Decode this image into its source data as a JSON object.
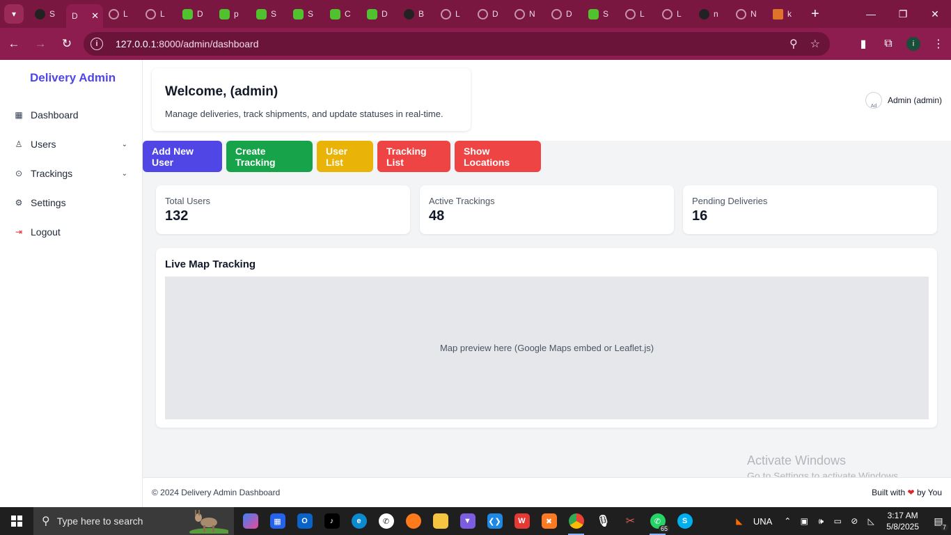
{
  "browser": {
    "tabs": [
      {
        "letter": "S",
        "icon": "dark"
      },
      {
        "letter": "D",
        "icon": "active"
      },
      {
        "letter": "L",
        "icon": "globe"
      },
      {
        "letter": "L",
        "icon": "globe"
      },
      {
        "letter": "D",
        "icon": "green"
      },
      {
        "letter": "p",
        "icon": "green"
      },
      {
        "letter": "S",
        "icon": "green"
      },
      {
        "letter": "S",
        "icon": "green"
      },
      {
        "letter": "C",
        "icon": "green"
      },
      {
        "letter": "D",
        "icon": "green"
      },
      {
        "letter": "B",
        "icon": "dark"
      },
      {
        "letter": "L",
        "icon": "globe"
      },
      {
        "letter": "D",
        "icon": "globe"
      },
      {
        "letter": "N",
        "icon": "globe"
      },
      {
        "letter": "D",
        "icon": "globe"
      },
      {
        "letter": "S",
        "icon": "green"
      },
      {
        "letter": "L",
        "icon": "globe"
      },
      {
        "letter": "L",
        "icon": "globe"
      },
      {
        "letter": "n",
        "icon": "dark"
      },
      {
        "letter": "N",
        "icon": "globe"
      },
      {
        "letter": "k",
        "icon": "tri"
      }
    ],
    "url_host": "127.0.0.1",
    "url_rest": ":8000/admin/dashboard",
    "profile_initial": "i"
  },
  "sidebar": {
    "brand": "Delivery Admin",
    "items": [
      {
        "label": "Dashboard",
        "icon": "grid-icon"
      },
      {
        "label": "Users",
        "icon": "user-icon",
        "expandable": true
      },
      {
        "label": "Trackings",
        "icon": "location-pin-icon",
        "expandable": true
      },
      {
        "label": "Settings",
        "icon": "gear-icon"
      },
      {
        "label": "Logout",
        "icon": "logout-icon"
      }
    ]
  },
  "header": {
    "welcome_title": "Welcome, (admin)",
    "welcome_subtitle": "Manage deliveries, track shipments, and update statuses in real-time.",
    "user_name": "Admin (admin)",
    "avatar_alt": "Ad"
  },
  "actions": {
    "add_user": "Add New User",
    "create_tracking": "Create Tracking",
    "user_list": "User List",
    "tracking_list": "Tracking List",
    "show_locations": "Show Locations"
  },
  "stats": [
    {
      "label": "Total Users",
      "value": "132"
    },
    {
      "label": "Active Trackings",
      "value": "48"
    },
    {
      "label": "Pending Deliveries",
      "value": "16"
    }
  ],
  "map": {
    "title": "Live Map Tracking",
    "placeholder": "Map preview here (Google Maps embed or Leaflet.js)"
  },
  "footer": {
    "copyright": "© 2024 Delivery Admin Dashboard",
    "built_prefix": "Built with",
    "built_suffix": "by You"
  },
  "watermark": {
    "title": "Activate Windows",
    "subtitle": "Go to Settings to activate Windows."
  },
  "taskbar": {
    "search_placeholder": "Type here to search",
    "whatsapp_badge": "65",
    "language": "UNA",
    "time": "3:17 AM",
    "date": "5/8/2025",
    "notifications": "7"
  },
  "colors": {
    "accent": "#4f46e5",
    "browser_frame": "#7a1741",
    "btn_green": "#16a34a",
    "btn_yellow": "#eab308",
    "btn_red": "#ef4444"
  }
}
